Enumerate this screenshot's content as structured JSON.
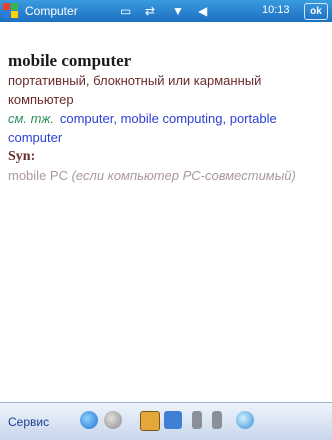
{
  "titlebar": {
    "app_title": "Computer",
    "time": "10:13",
    "ok_label": "ok"
  },
  "entry": {
    "headword": "mobile computer",
    "translation": "портативный, блокнотный или карманный компьютер",
    "see_marker": "см. тж.",
    "see_links": [
      "computer,",
      "mobile computing,",
      "portable computer"
    ],
    "syn_label": "Syn:",
    "synonym": "mobile PC",
    "synonym_note": "(если компьютер PC-совместимый)"
  },
  "toolbar": {
    "menu_label": "Сервис"
  },
  "colors": {
    "titlebar": "#1c6fc0",
    "headword": "#1a1a1a",
    "translation": "#6a2b2b",
    "see_marker": "#2f8f5a",
    "link": "#2b3fd6",
    "synonym": "#a99a9a"
  }
}
